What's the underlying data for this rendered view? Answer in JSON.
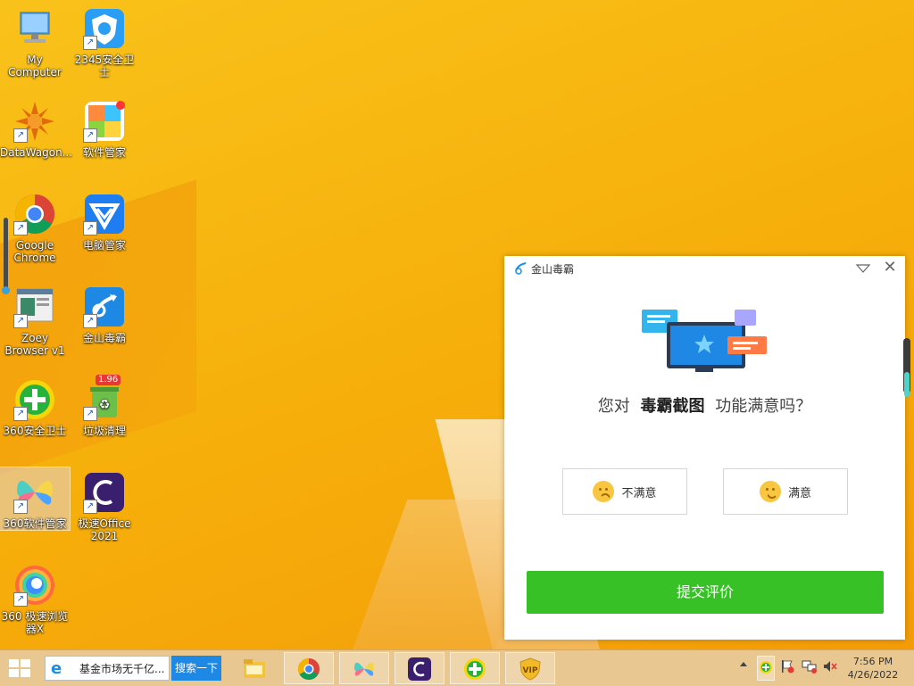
{
  "desktop": {
    "icons": [
      {
        "label": "My Computer"
      },
      {
        "label": "2345安全卫士"
      },
      {
        "label": "DataWagon..."
      },
      {
        "label": "软件管家"
      },
      {
        "label": "Google Chrome"
      },
      {
        "label": "电脑管家"
      },
      {
        "label": "Zoey Browser v1"
      },
      {
        "label": "金山毒霸"
      },
      {
        "label": "360安全卫士"
      },
      {
        "label": "垃圾清理",
        "badge": "1.96"
      },
      {
        "label": "360软件管家"
      },
      {
        "label": "极速Office 2021"
      },
      {
        "label": "360 极速浏览器X"
      }
    ]
  },
  "popup": {
    "app_title": "金山毒霸",
    "question_prefix": "您对",
    "question_feature": "毒霸截图",
    "question_suffix": "功能满意吗？",
    "dissatisfied_label": "不满意",
    "satisfied_label": "满意",
    "submit_label": "提交评价",
    "close_glyph": "✕"
  },
  "taskbar": {
    "search_text": "基金市场无千亿...",
    "search_button": "搜索一下",
    "clock_time": "7:56 PM",
    "clock_date": "4/26/2022",
    "apps": [
      "file-explorer",
      "google-chrome",
      "360-software-manager",
      "speed-office",
      "360-security",
      "vip-shield"
    ]
  },
  "colors": {
    "desktop_bg": "#f7b40c",
    "submit_green": "#37c127",
    "search_blue": "#1e88e5"
  }
}
